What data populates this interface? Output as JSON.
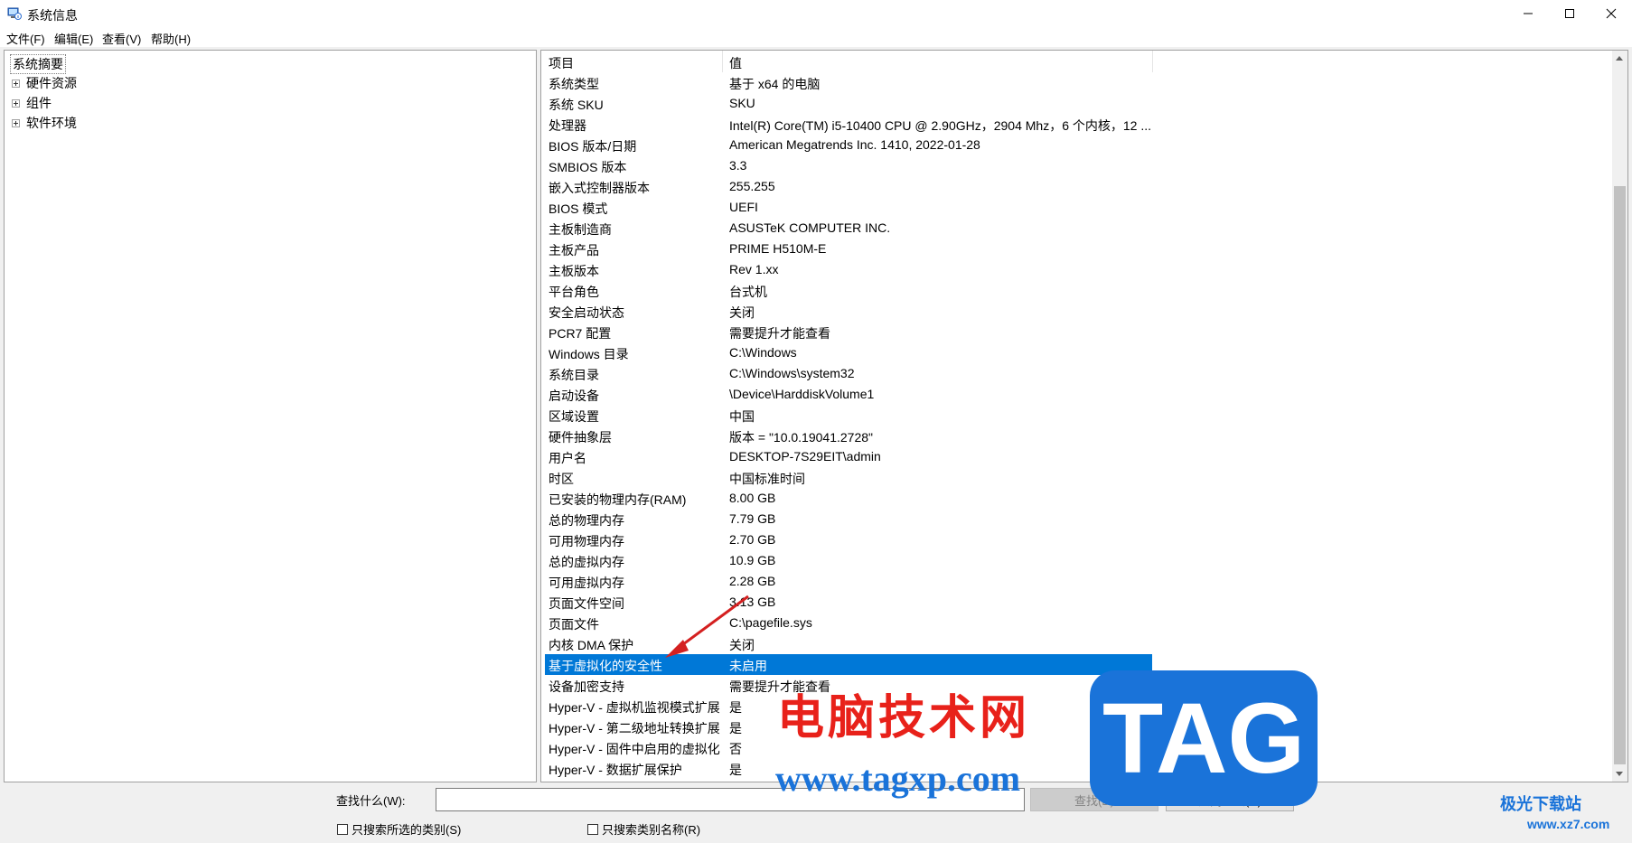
{
  "window": {
    "title": "系统信息",
    "minimize_label": "—",
    "maximize_label": "☐",
    "close_label": "✕"
  },
  "menu": [
    "文件(F)",
    "编辑(E)",
    "查看(V)",
    "帮助(H)"
  ],
  "tree": {
    "root": "系统摘要",
    "children": [
      "硬件资源",
      "组件",
      "软件环境"
    ]
  },
  "table": {
    "headers": [
      "项目",
      "值"
    ],
    "selected_index": 28,
    "rows": [
      [
        "系统类型",
        "基于 x64 的电脑"
      ],
      [
        "系统 SKU",
        "SKU"
      ],
      [
        "处理器",
        "Intel(R) Core(TM) i5-10400 CPU @ 2.90GHz，2904 Mhz，6 个内核，12 ..."
      ],
      [
        "BIOS 版本/日期",
        "American Megatrends Inc. 1410, 2022-01-28"
      ],
      [
        "SMBIOS 版本",
        "3.3"
      ],
      [
        "嵌入式控制器版本",
        "255.255"
      ],
      [
        "BIOS 模式",
        "UEFI"
      ],
      [
        "主板制造商",
        "ASUSTeK COMPUTER INC."
      ],
      [
        "主板产品",
        "PRIME H510M-E"
      ],
      [
        "主板版本",
        "Rev 1.xx"
      ],
      [
        "平台角色",
        "台式机"
      ],
      [
        "安全启动状态",
        "关闭"
      ],
      [
        "PCR7 配置",
        "需要提升才能查看"
      ],
      [
        "Windows 目录",
        "C:\\Windows"
      ],
      [
        "系统目录",
        "C:\\Windows\\system32"
      ],
      [
        "启动设备",
        "\\Device\\HarddiskVolume1"
      ],
      [
        "区域设置",
        "中国"
      ],
      [
        "硬件抽象层",
        "版本 = \"10.0.19041.2728\""
      ],
      [
        "用户名",
        "DESKTOP-7S29EIT\\admin"
      ],
      [
        "时区",
        "中国标准时间"
      ],
      [
        "已安装的物理内存(RAM)",
        "8.00 GB"
      ],
      [
        "总的物理内存",
        "7.79 GB"
      ],
      [
        "可用物理内存",
        "2.70 GB"
      ],
      [
        "总的虚拟内存",
        "10.9 GB"
      ],
      [
        "可用虚拟内存",
        "2.28 GB"
      ],
      [
        "页面文件空间",
        "3.13 GB"
      ],
      [
        "页面文件",
        "C:\\pagefile.sys"
      ],
      [
        "内核 DMA 保护",
        "关闭"
      ],
      [
        "基于虚拟化的安全性",
        "未启用"
      ],
      [
        "设备加密支持",
        "需要提升才能查看"
      ],
      [
        "Hyper-V - 虚拟机监视模式扩展",
        "是"
      ],
      [
        "Hyper-V - 第二级地址转换扩展",
        "是"
      ],
      [
        "Hyper-V - 固件中启用的虚拟化",
        "否"
      ],
      [
        "Hyper-V - 数据扩展保护",
        "是"
      ]
    ]
  },
  "find": {
    "label": "查找什么(W):",
    "value": "",
    "find_button": "查找(D)",
    "close_find_button": "关闭查找(C)",
    "checkbox_selected_category": "只搜索所选的类别(S)",
    "checkbox_category_names": "只搜索类别名称(R)"
  },
  "watermark": {
    "text": "电脑技术网",
    "url": "www.tagxp.com",
    "badge": "TAG",
    "corner_text": "极光下载站",
    "corner_url": "www.xz7.com"
  },
  "colors": {
    "selection": "#0078d7",
    "annotation_arrow": "#d42020"
  }
}
